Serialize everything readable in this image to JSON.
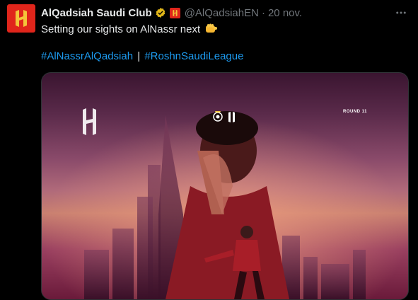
{
  "author": {
    "name": "AlQadsiah Saudi Club",
    "handle": "@AlQadsiahEN",
    "date": "20 nov.",
    "separator": "·"
  },
  "tweet": {
    "text": "Setting our sights on AlNassr next",
    "emoji_icon": "fist-icon",
    "hashtags": [
      "#AlNassrAlQadsiah",
      "#RoshnSaudiLeague"
    ],
    "hashtag_separator": "|"
  },
  "media": {
    "round_label": "ROUND 11"
  },
  "colors": {
    "background": "#000000",
    "text": "#e7e9ea",
    "secondary": "#71767b",
    "link": "#1d9bf0",
    "brand_red": "#e0251b",
    "verified_gold": "#e2b719"
  }
}
